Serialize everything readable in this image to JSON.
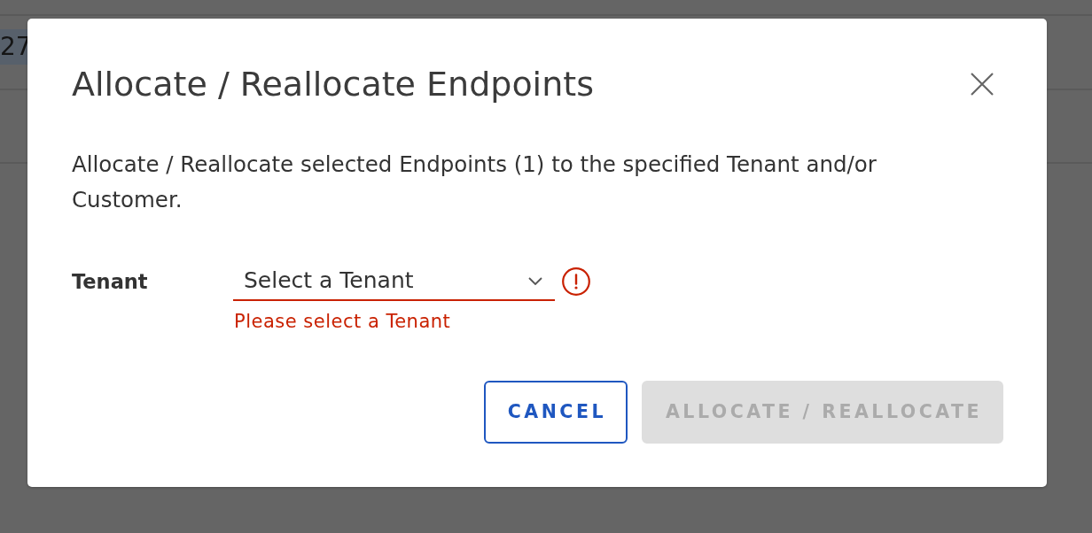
{
  "background": {
    "cell_text": "27"
  },
  "dialog": {
    "title": "Allocate / Reallocate Endpoints",
    "description": "Allocate / Reallocate selected Endpoints (1) to the specified Tenant and/or Customer.",
    "fields": [
      {
        "label": "Tenant",
        "kind": "select",
        "placeholder": "Select a Tenant",
        "invalid": true,
        "error": "Please select a Tenant"
      }
    ],
    "buttons": [
      {
        "label": "CANCEL",
        "kind": "outline",
        "disabled": false
      },
      {
        "label": "ALLOCATE / REALLOCATE",
        "kind": "primary",
        "disabled": true
      }
    ]
  }
}
